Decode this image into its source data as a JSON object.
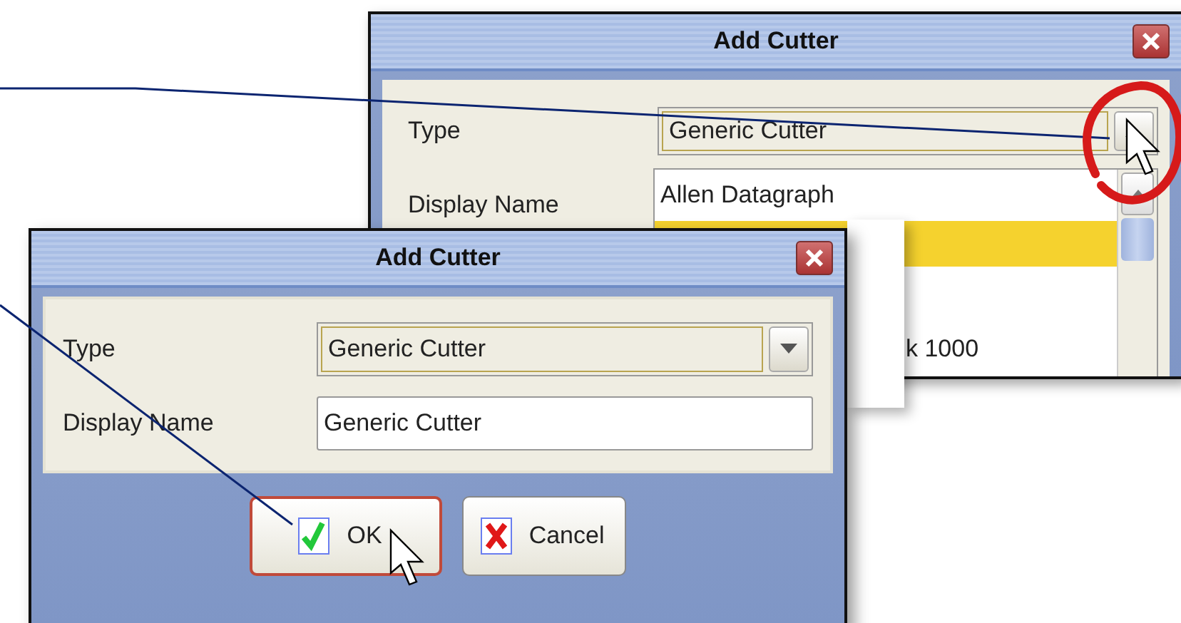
{
  "back_dialog": {
    "title": "Add Cutter",
    "type_label": "Type",
    "type_value": "Generic Cutter",
    "display_name_label": "Display Name",
    "list_items": [
      {
        "label": "Allen Datagraph",
        "selected": false
      },
      {
        "selected": true
      },
      {
        "selected": false
      },
      {
        "label": "k 1000",
        "selected": false
      }
    ]
  },
  "front_dialog": {
    "title": "Add Cutter",
    "type_label": "Type",
    "type_value": "Generic Cutter",
    "display_name_label": "Display Name",
    "display_name_value": "Generic Cutter",
    "buttons": [
      {
        "label": "OK",
        "kind": "ok",
        "focused": true
      },
      {
        "label": "Cancel",
        "kind": "cancel",
        "focused": false
      }
    ]
  }
}
